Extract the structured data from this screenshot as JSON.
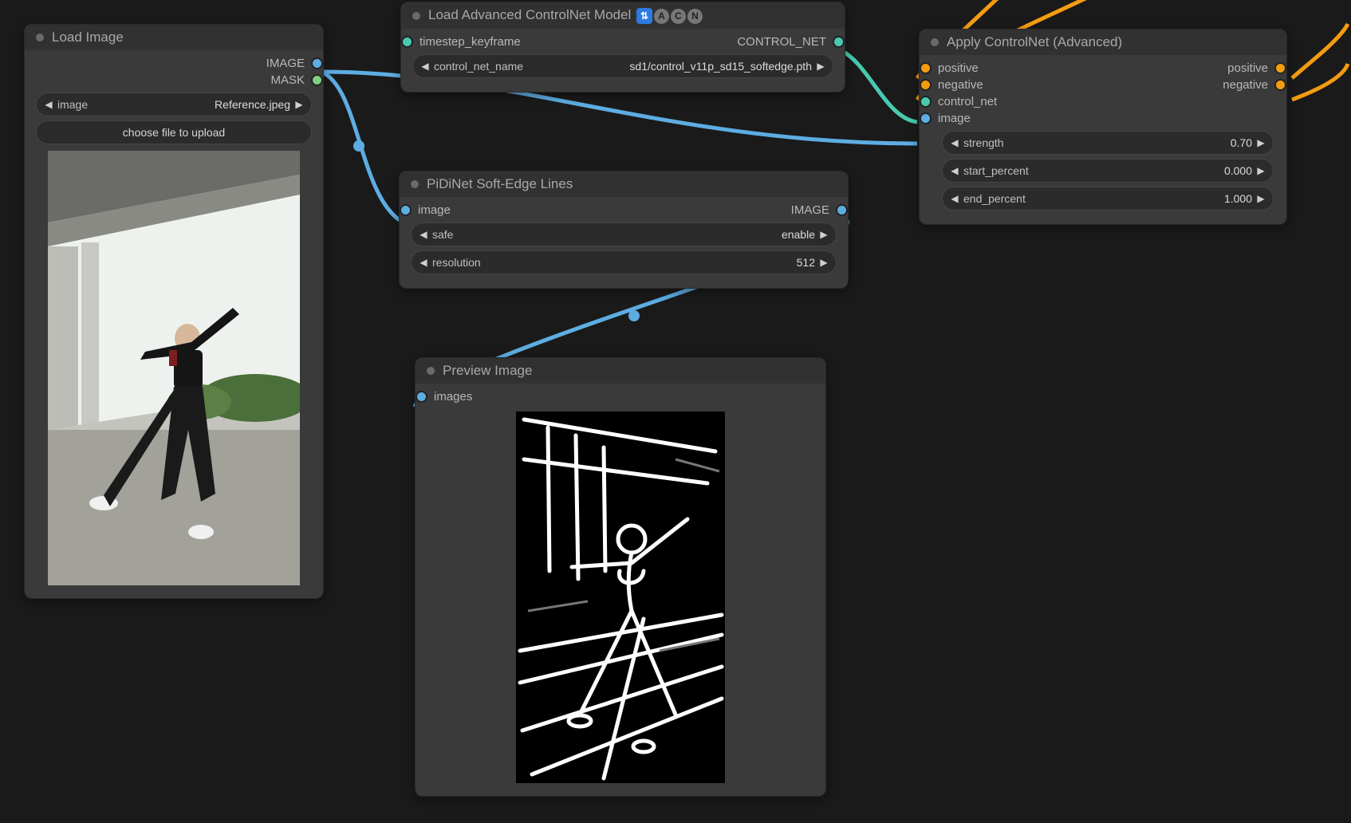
{
  "load_image": {
    "title": "Load Image",
    "out_image": "IMAGE",
    "out_mask": "MASK",
    "image_file": "Reference.jpeg",
    "image_label": "image",
    "choose_file": "choose file to upload"
  },
  "load_controlnet": {
    "title": "Load Advanced ControlNet Model 🛂🅐🅒🅝",
    "title_base": "Load Advanced ControlNet Model",
    "in_timestep": "timestep_keyframe",
    "out_controlnet": "CONTROL_NET",
    "cnet_name_label": "control_net_name",
    "cnet_name_value": "sd1/control_v11p_sd15_softedge.pth"
  },
  "pidinet": {
    "title": "PiDiNet Soft-Edge Lines",
    "in_image": "image",
    "out_image": "IMAGE",
    "safe_label": "safe",
    "safe_value": "enable",
    "resolution_label": "resolution",
    "resolution_value": "512"
  },
  "apply_cn": {
    "title": "Apply ControlNet (Advanced)",
    "in_positive": "positive",
    "in_negative": "negative",
    "in_controlnet": "control_net",
    "in_image": "image",
    "out_positive": "positive",
    "out_negative": "negative",
    "strength_label": "strength",
    "strength_value": "0.70",
    "start_label": "start_percent",
    "start_value": "0.000",
    "end_label": "end_percent",
    "end_value": "1.000"
  },
  "preview": {
    "title": "Preview Image",
    "in_images": "images"
  }
}
